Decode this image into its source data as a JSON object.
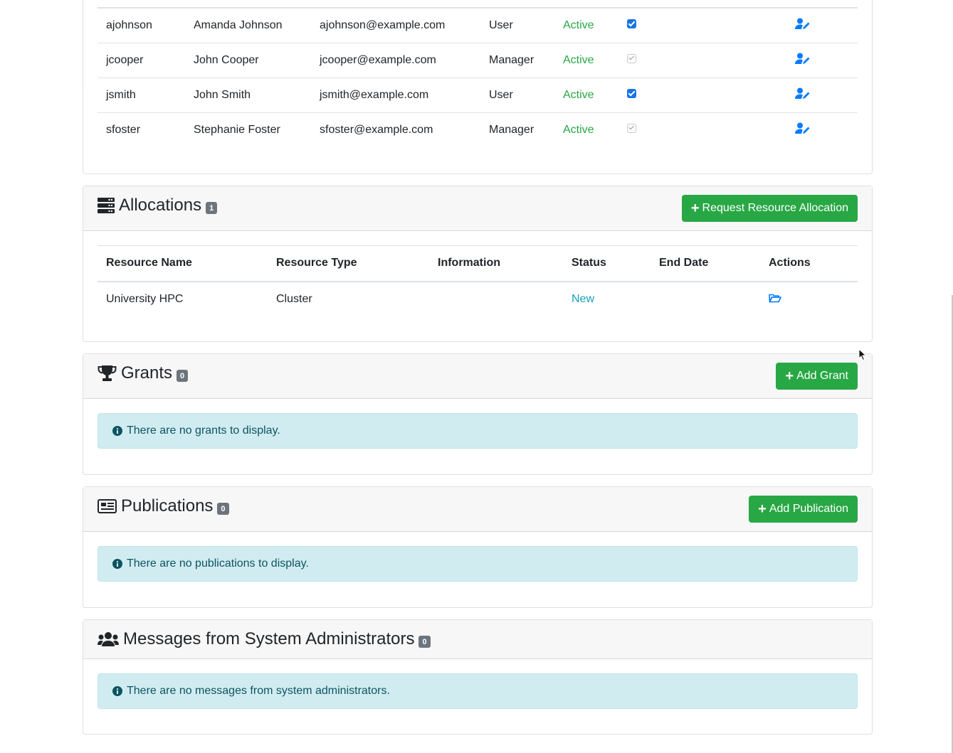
{
  "users": {
    "rows": [
      {
        "username": "ajohnson",
        "name": "Amanda Johnson",
        "email": "ajohnson@example.com",
        "role": "User",
        "status": "Active",
        "notify_checked": true,
        "notify_disabled": false
      },
      {
        "username": "jcooper",
        "name": "John Cooper",
        "email": "jcooper@example.com",
        "role": "Manager",
        "status": "Active",
        "notify_checked": true,
        "notify_disabled": true
      },
      {
        "username": "jsmith",
        "name": "John Smith",
        "email": "jsmith@example.com",
        "role": "User",
        "status": "Active",
        "notify_checked": true,
        "notify_disabled": false
      },
      {
        "username": "sfoster",
        "name": "Stephanie Foster",
        "email": "sfoster@example.com",
        "role": "Manager",
        "status": "Active",
        "notify_checked": true,
        "notify_disabled": true
      }
    ]
  },
  "allocations": {
    "title": "Allocations",
    "count": "1",
    "button_label": "Request Resource Allocation",
    "columns": [
      "Resource Name",
      "Resource Type",
      "Information",
      "Status",
      "End Date",
      "Actions"
    ],
    "rows": [
      {
        "resource_name": "University HPC",
        "resource_type": "Cluster",
        "information": "",
        "status": "New",
        "end_date": ""
      }
    ]
  },
  "grants": {
    "title": "Grants",
    "count": "0",
    "button_label": "Add Grant",
    "empty_message": "There are no grants to display."
  },
  "publications": {
    "title": "Publications",
    "count": "0",
    "button_label": "Add Publication",
    "empty_message": "There are no publications to display."
  },
  "messages": {
    "title": "Messages from System Administrators",
    "count": "0",
    "empty_message": "There are no messages from system administrators."
  },
  "colors": {
    "success": "#28a745",
    "info_text": "#17a2b8",
    "link": "#007bff",
    "alert_bg": "#d1ecf1",
    "badge": "#6c757d"
  },
  "icons": {
    "edit_user": "user-edit-icon",
    "allocation_detail": "folder-open-icon",
    "allocations": "server-icon",
    "grants": "trophy-icon",
    "publications": "newspaper-icon",
    "messages": "users-icon",
    "info": "info-circle-icon",
    "add": "plus-icon"
  }
}
